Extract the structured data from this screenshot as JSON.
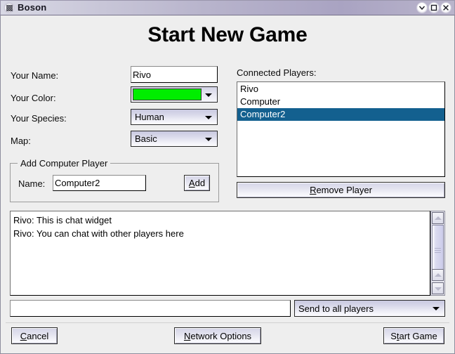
{
  "window": {
    "title": "Boson",
    "icon": "app-dots-icon",
    "buttons": [
      {
        "name": "minimize-button",
        "glyph": "chevron-down-icon"
      },
      {
        "name": "maximize-button",
        "glyph": "square-icon"
      },
      {
        "name": "close-button",
        "glyph": "close-x-icon"
      }
    ]
  },
  "heading": "Start New Game",
  "form": {
    "name_label": "Your Name:",
    "name_value": "Rivo",
    "color_label": "Your Color:",
    "color_value": "#00ee00",
    "species_label": "Your Species:",
    "species_value": "Human",
    "map_label": "Map:",
    "map_value": "Basic"
  },
  "add_computer": {
    "group_title": "Add Computer Player",
    "name_label": "Name:",
    "name_value": "Computer2",
    "add_button": "Add",
    "add_button_accel": "A"
  },
  "players": {
    "label": "Connected Players:",
    "items": [
      {
        "name": "Rivo",
        "selected": false
      },
      {
        "name": "Computer",
        "selected": false
      },
      {
        "name": "Computer2",
        "selected": true
      }
    ],
    "remove_button": "Remove Player",
    "remove_button_accel": "R",
    "selection_color": "#13608f"
  },
  "chat": {
    "lines": [
      "Rivo: This is chat widget",
      "Rivo: You can chat with other players here"
    ],
    "input_value": "",
    "input_placeholder": "",
    "target_value": "Send to all players"
  },
  "footer": {
    "cancel": "Cancel",
    "cancel_accel": "C",
    "network_options": "Network Options",
    "network_options_accel": "N",
    "start_game": "Start Game",
    "start_game_accel": "t"
  }
}
